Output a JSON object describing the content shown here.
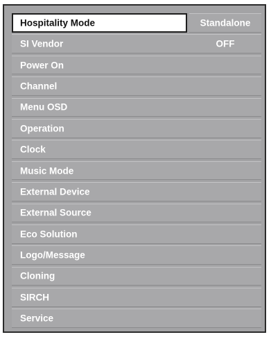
{
  "menu": {
    "items": [
      {
        "label": "Hospitality Mode",
        "value": "Standalone",
        "selected": true
      },
      {
        "label": "SI Vendor",
        "value": "OFF"
      },
      {
        "label": "Power On",
        "value": ""
      },
      {
        "label": "Channel",
        "value": ""
      },
      {
        "label": "Menu OSD",
        "value": ""
      },
      {
        "label": "Operation",
        "value": ""
      },
      {
        "label": "Clock",
        "value": ""
      },
      {
        "label": "Music Mode",
        "value": ""
      },
      {
        "label": "External Device",
        "value": ""
      },
      {
        "label": "External Source",
        "value": ""
      },
      {
        "label": "Eco Solution",
        "value": ""
      },
      {
        "label": "Logo/Message",
        "value": ""
      },
      {
        "label": "Cloning",
        "value": ""
      },
      {
        "label": "SIRCH",
        "value": ""
      },
      {
        "label": "Service",
        "value": ""
      }
    ]
  },
  "colors": {
    "menu_background": "#a3a3a5",
    "row_background": "#a8a8aa",
    "selected_background": "#ffffff",
    "frame_border": "#2a2a2a",
    "text": "#ffffff",
    "selected_text": "#111111"
  }
}
